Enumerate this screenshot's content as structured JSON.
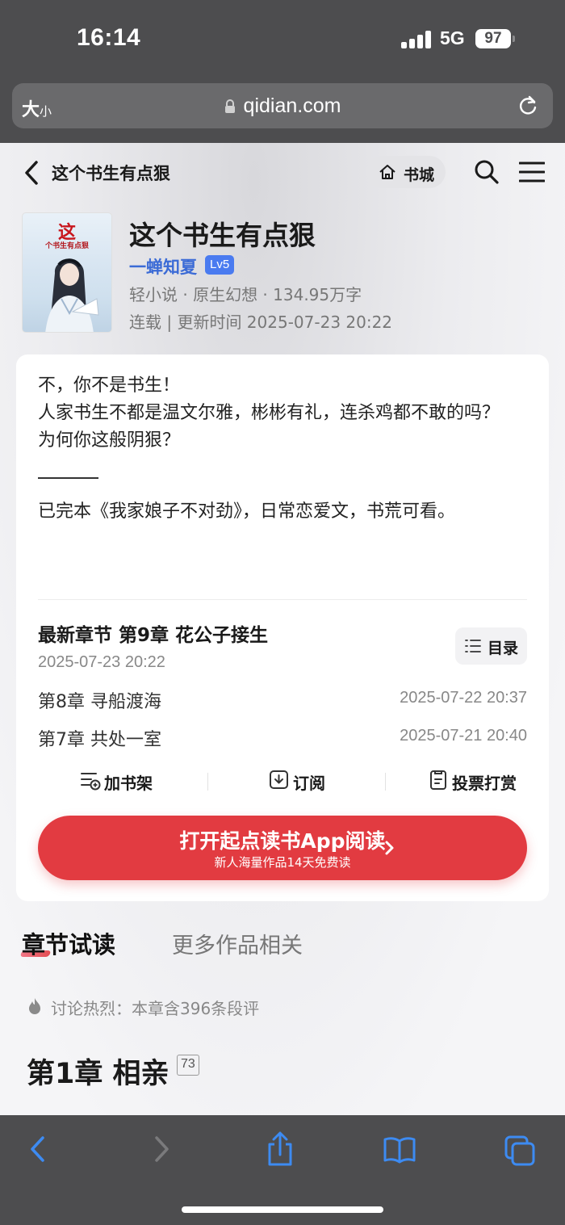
{
  "status": {
    "time": "16:14",
    "network": "5G",
    "battery": "97"
  },
  "browser": {
    "text_size_label": "大",
    "text_size_small": "小",
    "url": "qidian.com"
  },
  "header": {
    "title": "这个书生有点狠",
    "shelf_label": "书城"
  },
  "book": {
    "cover_title": "这",
    "cover_subtitle": "个书生有点狠",
    "title": "这个书生有点狠",
    "author": "一蝉知夏",
    "level": "Lv5",
    "meta_line": "轻小说 · 原生幻想 · 134.95万字",
    "status_line": "连载 | 更新时间 2025-07-23 20:22"
  },
  "intro": {
    "lines": [
      "不，你不是书生！",
      "人家书生不都是温文尔雅，彬彬有礼，连杀鸡都不敢的吗？",
      "为何你这般阴狠？"
    ],
    "note": "已完本《我家娘子不对劲》，日常恋爱文，书荒可看。"
  },
  "latest": {
    "label": "最新章节 第9章 花公子接生",
    "time": "2025-07-23 20:22",
    "toc_label": "目录"
  },
  "chapters": [
    {
      "name": "第8章 寻船渡海",
      "time": "2025-07-22 20:37"
    },
    {
      "name": "第7章 共处一室",
      "time": "2025-07-21 20:40"
    }
  ],
  "actions": {
    "add_shelf": "加书架",
    "subscribe": "订阅",
    "vote_reward": "投票打赏"
  },
  "open_app": {
    "main": "打开起点读书App阅读",
    "sub": "新人海量作品14天免费读"
  },
  "tabs": {
    "active": "章节试读",
    "inactive": "更多作品相关"
  },
  "reading": {
    "hot_text": "讨论热烈：本章含396条段评",
    "chapter_title": "第1章 相亲",
    "comment_count": "73"
  },
  "colors": {
    "accent_red": "#e23b41",
    "author_blue": "#3b6bd6",
    "level_blue": "#4a7bf0",
    "safari_blue": "#3d8bf2"
  }
}
